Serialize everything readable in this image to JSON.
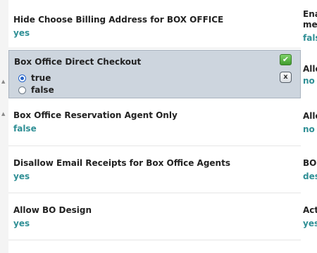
{
  "settings": [
    {
      "title": "Hide Choose Billing Address for BOX OFFICE",
      "value": "yes"
    },
    {
      "title": "Box Office Direct Checkout",
      "options": [
        {
          "label": "true",
          "selected": true
        },
        {
          "label": "false",
          "selected": false
        }
      ],
      "save_icon": "check-icon",
      "cancel_icon": "x-icon",
      "cancel_label": "x"
    },
    {
      "title": "Box Office Reservation Agent Only",
      "value": "false"
    },
    {
      "title": "Disallow Email Receipts for Box Office Agents",
      "value": "yes"
    },
    {
      "title": "Allow BO Design",
      "value": "yes"
    }
  ],
  "right_column": [
    {
      "title_line1": "Ena",
      "title_line2": "me",
      "value": "fals"
    },
    {
      "title": "Allo",
      "value": "no"
    },
    {
      "title": "Allo",
      "value": "no"
    },
    {
      "title": "BO",
      "value": "des"
    },
    {
      "title": "Act",
      "value": "yes"
    }
  ],
  "gutter": {
    "collapse_icon": "triangle-up-icon"
  },
  "colors": {
    "value_text": "#2f8f95",
    "edit_panel_bg": "#cdd5de",
    "radio_accent": "#2463c9",
    "save_green": "#4caf3a"
  }
}
